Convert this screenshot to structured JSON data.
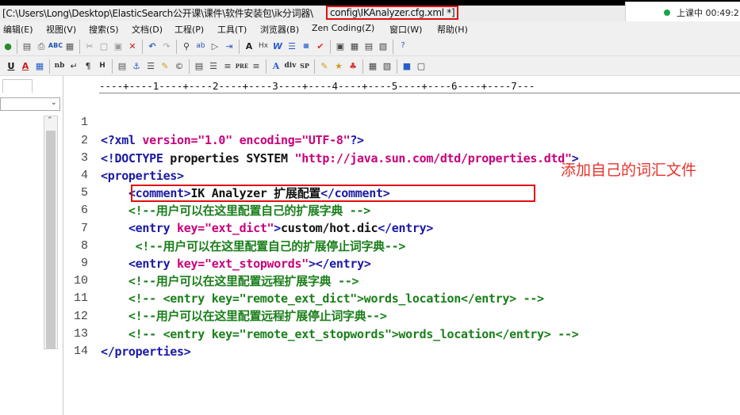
{
  "window": {
    "title_path": "[C:\\Users\\Long\\Desktop\\ElasticSearch公开课\\课件\\软件安装包\\ik分词器\\",
    "title_file": "config\\IKAnalyzer.cfg.xml *]"
  },
  "status": {
    "text": "上课中 00:49:2",
    "accent": "#1aa34a"
  },
  "menu": {
    "items": [
      "编辑(E)",
      "视图(V)",
      "搜索(S)",
      "文档(D)",
      "工程(P)",
      "工具(T)",
      "浏览器(B)",
      "Zen Coding(Z)",
      "窗口(W)",
      "帮助(H)"
    ]
  },
  "toolbar2": {
    "labels": [
      "nb",
      "div",
      "SP",
      "PRE",
      "A"
    ]
  },
  "ruler": {
    "text": "----+----1----+----2----+----3----+----4----+----5----+----6----+----7---"
  },
  "lines": [
    {
      "num": "1",
      "text": "<?xml version=\"1.0\" encoding=\"UTF-8\"?>"
    },
    {
      "num": "2",
      "text": "<!DOCTYPE properties SYSTEM \"http://java.sun.com/dtd/properties.dtd\">"
    },
    {
      "num": "3",
      "text": "<properties>"
    },
    {
      "num": "4",
      "text": "    <comment>IK Analyzer 扩展配置</comment>"
    },
    {
      "num": "5",
      "text": "    <!--用户可以在这里配置自己的扩展字典 -->"
    },
    {
      "num": "6",
      "text": "    <entry key=\"ext_dict\">custom/hot.dic</entry>"
    },
    {
      "num": "7",
      "text": "     <!--用户可以在这里配置自己的扩展停止词字典-->"
    },
    {
      "num": "8",
      "text": "    <entry key=\"ext_stopwords\"></entry>"
    },
    {
      "num": "9",
      "text": "    <!--用户可以在这里配置远程扩展字典 -->"
    },
    {
      "num": "10",
      "text": "    <!-- <entry key=\"remote_ext_dict\">words_location</entry> -->"
    },
    {
      "num": "11",
      "text": "    <!--用户可以在这里配置远程扩展停止词字典-->"
    },
    {
      "num": "12",
      "text": "    <!-- <entry key=\"remote_ext_stopwords\">words_location</entry> -->"
    },
    {
      "num": "13",
      "text": "</properties>"
    },
    {
      "num": "14",
      "text": ""
    }
  ],
  "annotation": {
    "text": "添加自己的词汇文件",
    "color": "#e8322a"
  },
  "colors": {
    "tag": "#1a1aa6",
    "attr": "#c8007a",
    "comment": "#1a7f1a",
    "highlight": "#e01010"
  },
  "icons": {
    "toolbar1": [
      "open-icon",
      "save-icon",
      "print-icon",
      "spellcheck-icon",
      "properties-icon",
      "cut-icon",
      "copy-icon",
      "paste-icon",
      "delete-icon",
      "undo-icon",
      "redo-icon",
      "find-icon",
      "replace-icon",
      "goto-icon",
      "indent-icon",
      "font-icon",
      "hex-icon",
      "wordwrap-icon",
      "list-icon",
      "column-icon",
      "check-icon",
      "view1-icon",
      "view2-icon",
      "view3-icon",
      "view4-icon",
      "help-icon"
    ],
    "toolbar2": [
      "underline-icon",
      "font-color-icon",
      "table-icon",
      "nb-icon",
      "return-icon",
      "paragraph-icon",
      "hr-icon",
      "image-icon",
      "anchor-icon",
      "align-icon",
      "edit-icon",
      "copyright-icon",
      "frame-icon",
      "list-icon",
      "pre-icon",
      "list2-icon",
      "A-icon",
      "div-icon",
      "sp-icon",
      "form-icon",
      "css-icon",
      "script-icon",
      "grid-icon",
      "table2-icon",
      "color-icon",
      "window-icon"
    ]
  }
}
